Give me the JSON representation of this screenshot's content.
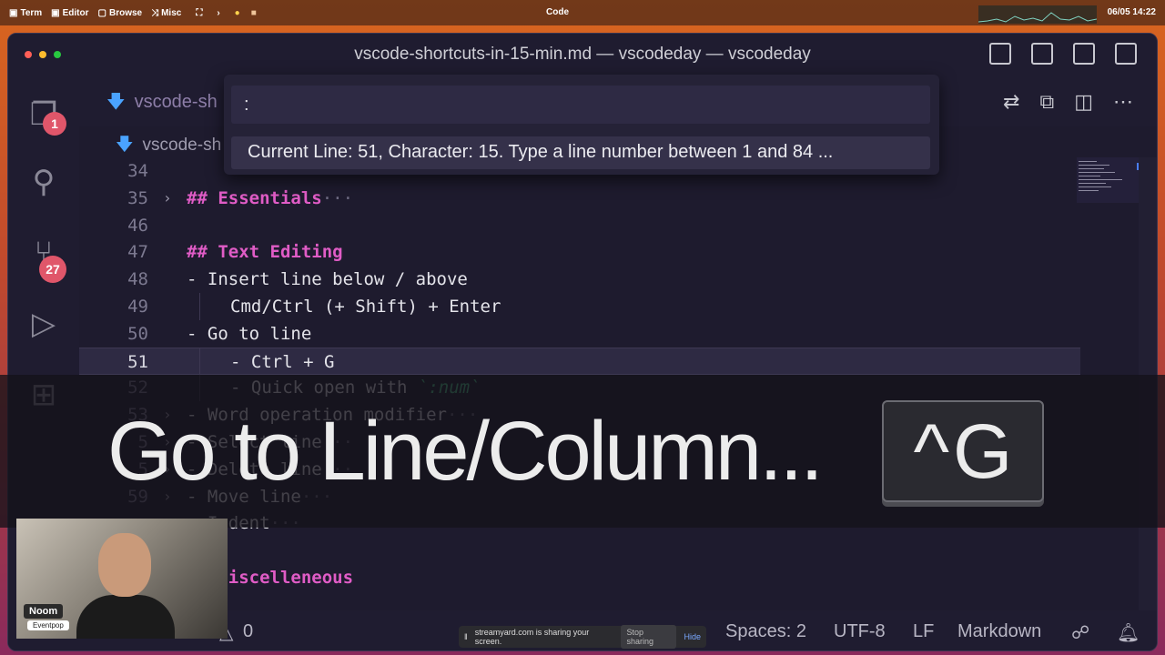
{
  "menubar": {
    "items": [
      {
        "icon": "terminal-icon",
        "label": "Term"
      },
      {
        "icon": "editor-icon",
        "label": "Editor"
      },
      {
        "icon": "browser-icon",
        "label": "Browse"
      },
      {
        "icon": "shuffle-icon",
        "label": "Misc"
      }
    ],
    "center": "Code",
    "clock": "06/05  14:22"
  },
  "window": {
    "title": "vscode-shortcuts-in-15-min.md — vscodeday — vscodeday",
    "tab_label": "vscode-sh",
    "breadcrumb": "vscode-sh"
  },
  "activity": {
    "explorer_badge": "1",
    "scm_badge": "27"
  },
  "quick_input": {
    "value": ":",
    "message": "Current Line: 51, Character: 15. Type a line number between 1 and 84 ..."
  },
  "lines": [
    {
      "num": "34",
      "text": "",
      "fold": false
    },
    {
      "num": "35",
      "text": "## Essentials",
      "heading": true,
      "fold": true,
      "ellipsis": true
    },
    {
      "num": "46",
      "text": "",
      "fold": false
    },
    {
      "num": "47",
      "text": "## Text Editing",
      "heading": true
    },
    {
      "num": "48",
      "text": "- Insert line below / above"
    },
    {
      "num": "49",
      "text": "Cmd/Ctrl (+ Shift) + Enter",
      "indent": true
    },
    {
      "num": "50",
      "text": "- Go to line"
    },
    {
      "num": "51",
      "text": "- Ctrl + G",
      "indent": true,
      "current": true
    },
    {
      "num": "52",
      "text": "- Quick open with ",
      "indent": true,
      "code": "`:num`"
    },
    {
      "num": "53",
      "text": "- Word operation modifier",
      "fold": true,
      "ellipsis": true
    },
    {
      "num": "5",
      "text": "- Select line",
      "fold": true,
      "ellipsis": true
    },
    {
      "num": "5",
      "text": "- Delete line",
      "fold": true,
      "ellipsis": true
    },
    {
      "num": "59",
      "text": "- Move line",
      "fold": true,
      "ellipsis": true
    },
    {
      "num": "",
      "text": "- Indent",
      "fold": true,
      "ellipsis": true
    },
    {
      "num": "",
      "text": "",
      "fold": false
    },
    {
      "num": "",
      "text": "## Miscelleneous",
      "heading": true
    }
  ],
  "caption": {
    "text": "Go to Line/Column...",
    "key_symbol": "^",
    "key_letter": "G"
  },
  "statusbar": {
    "problems": "0",
    "spaces": "Spaces: 2",
    "encoding": "UTF-8",
    "eol": "LF",
    "language": "Markdown"
  },
  "webcam": {
    "name": "Noom",
    "brand": "Eventpop"
  },
  "share": {
    "message": "streamyard.com is sharing your screen.",
    "stop_label": "Stop sharing",
    "hide_label": "Hide"
  },
  "colors": {
    "heading": "#e05cc6",
    "badge": "#e0566a",
    "code": "#4cc38a"
  }
}
